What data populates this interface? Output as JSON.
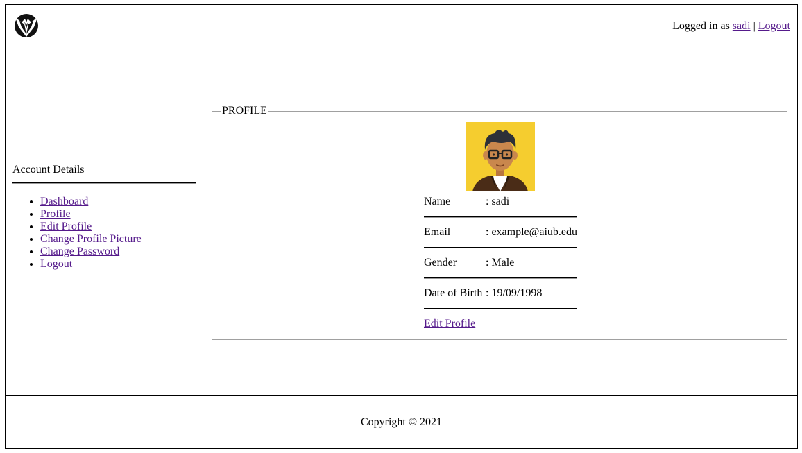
{
  "header": {
    "logged_in_prefix": "Logged in as",
    "username": "sadi",
    "separator": "|",
    "logout_label": "Logout",
    "logo_icon": "eagle-shield-logo-icon"
  },
  "sidebar": {
    "title": "Account Details",
    "items": [
      {
        "label": "Dashboard"
      },
      {
        "label": "Profile"
      },
      {
        "label": "Edit Profile"
      },
      {
        "label": "Change Profile Picture"
      },
      {
        "label": "Change Password"
      },
      {
        "label": "Logout"
      }
    ]
  },
  "profile": {
    "legend": "PROFILE",
    "avatar_icon": "user-avatar",
    "fields": [
      {
        "label": "Name",
        "value": ": sadi"
      },
      {
        "label": "Email",
        "value": ": example@aiub.edu"
      },
      {
        "label": "Gender",
        "value": ": Male"
      },
      {
        "label": "Date of Birth",
        "value": ": 19/09/1998"
      }
    ],
    "edit_label": "Edit Profile"
  },
  "footer": {
    "copyright": "Copyright © 2021"
  },
  "colors": {
    "link": "#551a8b",
    "avatar_bg": "#f5cd2f",
    "border": "#000000",
    "fieldset_border": "#a0a0a0"
  }
}
